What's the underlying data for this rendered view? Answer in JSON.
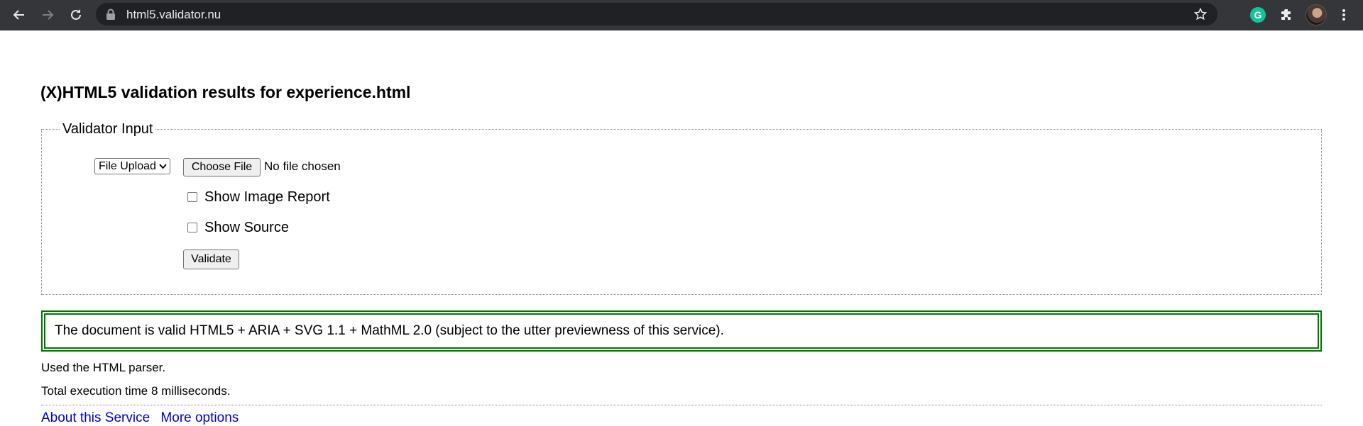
{
  "browser": {
    "url": "html5.validator.nu",
    "icons": {
      "back": "back-arrow-icon",
      "forward": "forward-arrow-icon",
      "reload": "reload-icon",
      "lock": "lock-icon",
      "bookmark": "star-icon",
      "grammarly": "grammarly-extension-icon",
      "extensions": "puzzle-extensions-icon",
      "profile": "profile-avatar",
      "menu": "kebab-menu-icon"
    },
    "grammarly_letter": "G"
  },
  "page": {
    "title": "(X)HTML5 validation results for experience.html",
    "validator_input": {
      "legend": "Validator Input",
      "input_mode": "File Upload",
      "choose_file_label": "Choose File",
      "file_status": "No file chosen",
      "show_image_report_label": "Show Image Report",
      "show_image_report_checked": false,
      "show_source_label": "Show Source",
      "show_source_checked": false,
      "validate_label": "Validate"
    },
    "result_message": "The document is valid HTML5 + ARIA + SVG 1.1 + MathML 2.0 (subject to the utter previewness of this service).",
    "parser_note": "Used the HTML parser.",
    "execution_time": "Total execution time 8 milliseconds.",
    "footer_links": [
      "About this Service",
      "More options"
    ]
  },
  "colors": {
    "toolbar_bg": "#35363a",
    "omnibox_bg": "#202124",
    "success_border": "#007800",
    "link": "#0000cc"
  }
}
